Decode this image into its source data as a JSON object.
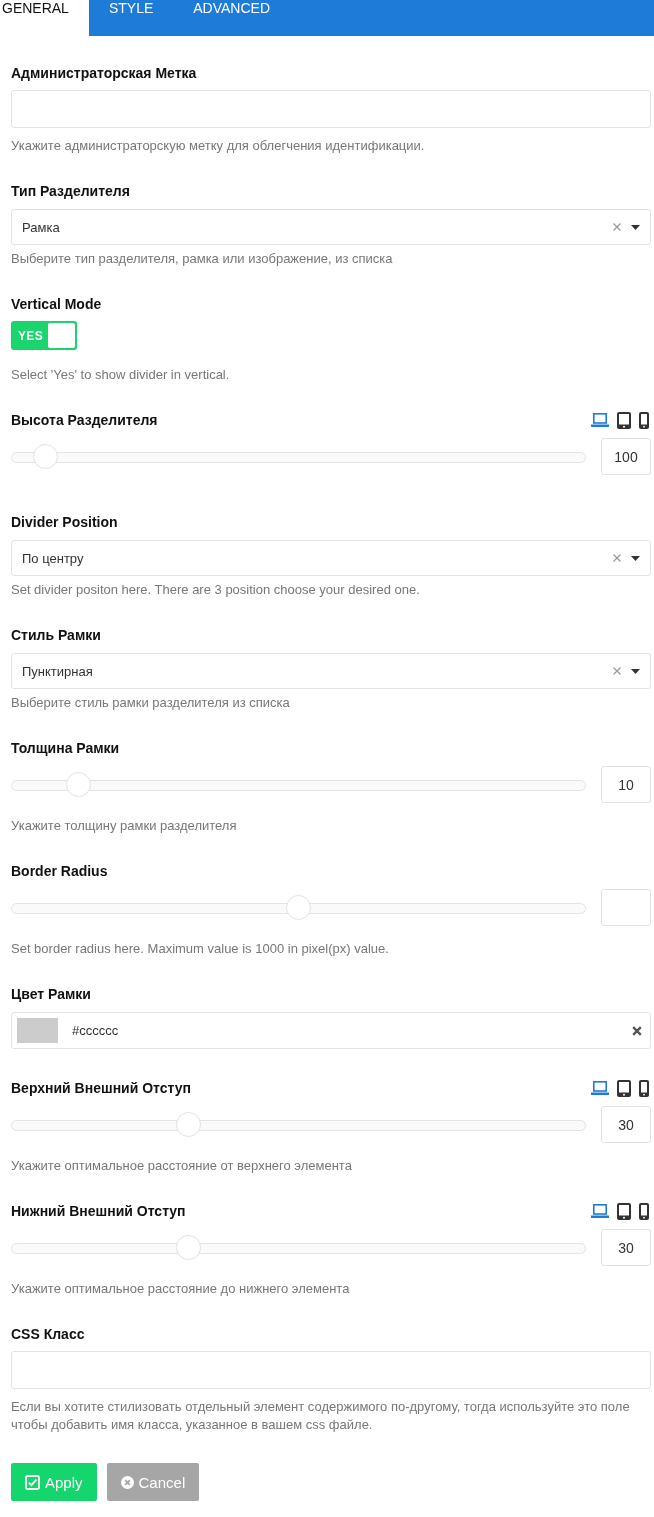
{
  "tabs": [
    {
      "label": "GENERAL",
      "selected": true
    },
    {
      "label": "STYLE",
      "selected": false
    },
    {
      "label": "ADVANCED",
      "selected": false
    }
  ],
  "fields": [
    {
      "kind": "text",
      "label": "Администраторская Метка",
      "help": "Укажите администраторскую метку для облегчения идентификации."
    },
    {
      "kind": "select",
      "label": "Тип Разделителя",
      "value": "Рамка",
      "help": "Выберите тип разделителя, рамка или изображение, из списка"
    },
    {
      "kind": "toggle",
      "label": "Vertical Mode",
      "on": true,
      "on_label": "YES",
      "help": "Select 'Yes' to show divider in vertical."
    },
    {
      "kind": "slider",
      "label": "Высота Разделителя",
      "devices": [
        {
          "kind": "laptop",
          "selected": true
        },
        {
          "kind": "tablet",
          "selected": false
        },
        {
          "kind": "phone",
          "selected": false
        }
      ],
      "level": 0.04,
      "value": "100"
    },
    {
      "kind": "select",
      "label": "Divider Position",
      "value": "По центру",
      "help": "Set divider positon here. There are 3 position choose your desired one."
    },
    {
      "kind": "select",
      "label": "Стиль Рамки",
      "value": "Пунктирная",
      "help": "Выберите стиль рамки разделителя из списка"
    },
    {
      "kind": "slider",
      "label": "Толщина Рамки",
      "level": 0.1,
      "value": "10",
      "help": "Укажите толщину рамки разделителя"
    },
    {
      "kind": "slider",
      "label": "Border Radius",
      "level": 0.5,
      "help": "Set border radius here. Maximum value is 1000 in pixel(px) value."
    },
    {
      "kind": "color",
      "label": "Цвет Рамки",
      "color": "#cccccc",
      "value": "#cccccc"
    },
    {
      "kind": "slider",
      "label": "Верхний Внешний Отступ",
      "devices": [
        {
          "kind": "laptop",
          "selected": true
        },
        {
          "kind": "tablet",
          "selected": false
        },
        {
          "kind": "phone",
          "selected": false
        }
      ],
      "level": 0.3,
      "value": "30",
      "help": "Укажите оптимальное расстояние от верхнего элемента"
    },
    {
      "kind": "slider",
      "label": "Нижний Внешний Отступ",
      "devices": [
        {
          "kind": "laptop",
          "selected": true
        },
        {
          "kind": "tablet",
          "selected": false
        },
        {
          "kind": "phone",
          "selected": false
        }
      ],
      "level": 0.3,
      "value": "30",
      "help": "Укажите оптимальное расстояние до нижнего элемента"
    },
    {
      "kind": "text",
      "label": "CSS Класс",
      "help": "Если вы хотите стилизовать отдельный элемент содержимого по-другому, тогда используйте это поле чтобы добавить имя класса, указанное в вашем css файле."
    }
  ],
  "buttons": [
    {
      "kind": "apply",
      "label": "Apply"
    },
    {
      "kind": "cancel",
      "label": "Cancel"
    }
  ]
}
